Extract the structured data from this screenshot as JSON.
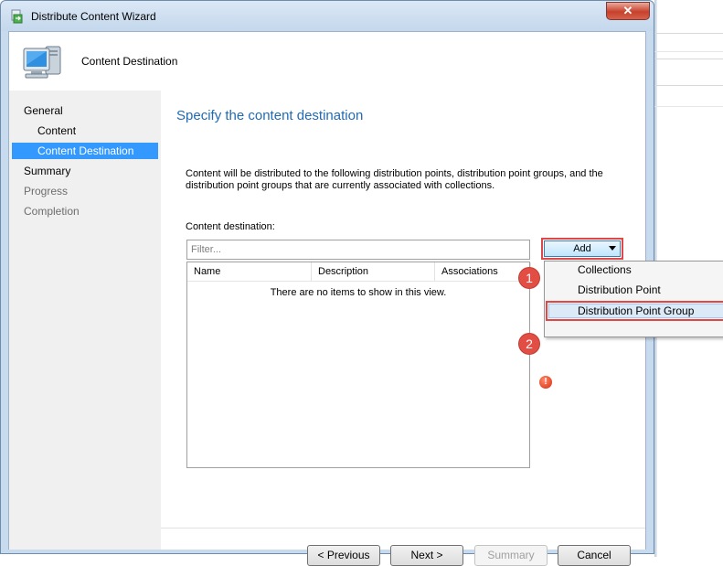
{
  "window": {
    "title": "Distribute Content Wizard",
    "close_label": "✕"
  },
  "header": {
    "title": "Content Destination"
  },
  "nav": {
    "items": [
      {
        "label": "General"
      },
      {
        "label": "Content"
      },
      {
        "label": "Content Destination"
      },
      {
        "label": "Summary"
      },
      {
        "label": "Progress"
      },
      {
        "label": "Completion"
      }
    ]
  },
  "content": {
    "title": "Specify the content destination",
    "description": "Content will be distributed to the following distribution points, distribution point groups, and the distribution point groups that are currently associated with collections.",
    "destination_label": "Content destination:",
    "filter_placeholder": "Filter...",
    "columns": [
      "Name",
      "Description",
      "Associations"
    ],
    "empty_text": "There are no items to show in this view."
  },
  "add_button": {
    "label": "Add"
  },
  "add_menu": {
    "items": [
      "Collections",
      "Distribution Point",
      "Distribution Point Group"
    ]
  },
  "markers": [
    "1",
    "2"
  ],
  "error_icon": {
    "glyph": "!"
  },
  "buttons": {
    "previous": "< Previous",
    "next": "Next >",
    "summary": "Summary",
    "cancel": "Cancel"
  }
}
